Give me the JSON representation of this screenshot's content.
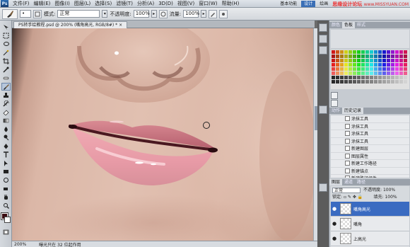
{
  "menubar": {
    "logo": "Ps",
    "items": [
      "文件(F)",
      "编辑(E)",
      "图像(I)",
      "图层(L)",
      "选择(S)",
      "滤镜(T)",
      "分析(A)",
      "3D(D)",
      "视图(V)",
      "窗口(W)",
      "帮助(H)"
    ],
    "workspace_buttons": [
      "基本功能",
      "设计",
      "绘画"
    ],
    "watermark": "思缘设计论坛",
    "watermark_url": "www.MISSYUAN.COM"
  },
  "options": {
    "mode_label": "模式:",
    "mode_value": "正常",
    "opacity_label": "不透明度:",
    "opacity_value": "100%",
    "flow_label": "流量:",
    "flow_value": "100%"
  },
  "document": {
    "tab_title": "PS转手绘教程.psd @ 200% (嘴角高光, RGB/8#) * ×"
  },
  "status": {
    "zoom": "200%",
    "info": "曝光只在 32 位起作用"
  },
  "panels": {
    "top_tabs": [
      "颜色",
      "色板",
      "样式"
    ],
    "history_tabs": [
      "动作",
      "历史记录"
    ],
    "history_items": [
      {
        "label": "涂抹工具",
        "active": false
      },
      {
        "label": "涂抹工具",
        "active": false
      },
      {
        "label": "涂抹工具",
        "active": false
      },
      {
        "label": "涂抹工具",
        "active": false
      },
      {
        "label": "新建图层",
        "active": false
      },
      {
        "label": "图层属性",
        "active": false
      },
      {
        "label": "新建工作路径",
        "active": false
      },
      {
        "label": "新建锚点",
        "active": false
      },
      {
        "label": "新建路径组件",
        "active": false
      },
      {
        "label": "新建锚点",
        "active": true
      }
    ],
    "layers_tabs": [
      "图层",
      "通道",
      "路径"
    ],
    "blend_mode": "正常",
    "opacity_label": "不透明度:",
    "opacity_value": "100%",
    "lock_label": "锁定:",
    "fill_label": "填充:",
    "fill_value": "100%",
    "layers": [
      {
        "name": "嘴角高光",
        "active": true
      },
      {
        "name": "嘴角",
        "active": false
      },
      {
        "name": "上高光",
        "active": false
      }
    ]
  },
  "colors": {
    "accent": "#3a6bc1",
    "lip_pink": "#e79aa6",
    "skin": "#dfbcac"
  },
  "icons": {
    "brush": "brush-icon",
    "eye": "eye-icon",
    "history_brush": "history-state-icon"
  }
}
